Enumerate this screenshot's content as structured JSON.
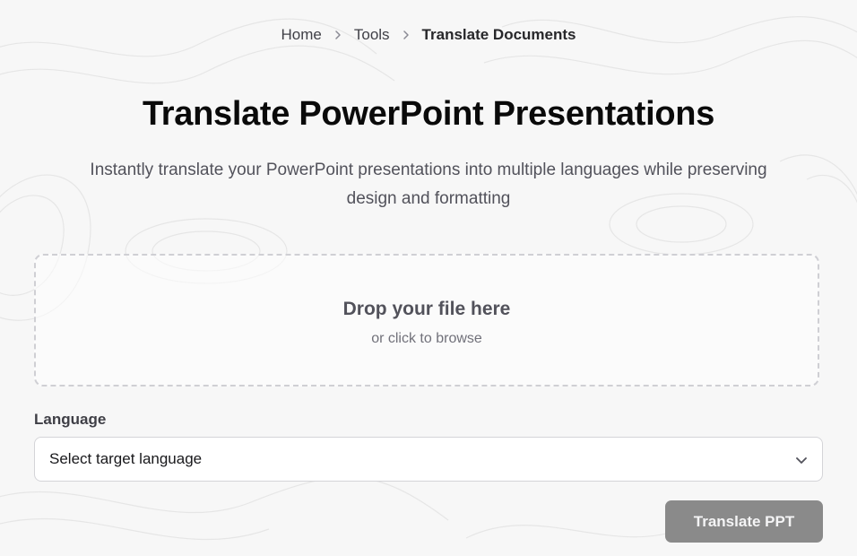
{
  "breadcrumb": {
    "items": [
      "Home",
      "Tools"
    ],
    "current": "Translate Documents"
  },
  "header": {
    "title": "Translate PowerPoint Presentations",
    "subtitle": "Instantly translate your PowerPoint presentations into multiple languages while preserving design and formatting"
  },
  "dropzone": {
    "title": "Drop your file here",
    "subtitle": "or click to browse"
  },
  "language": {
    "label": "Language",
    "selected": "Select target language"
  },
  "actions": {
    "translate_label": "Translate PPT"
  },
  "colors": {
    "background": "#f7f7f7",
    "button": "#8a8a8a",
    "title": "#0a0a0a"
  }
}
